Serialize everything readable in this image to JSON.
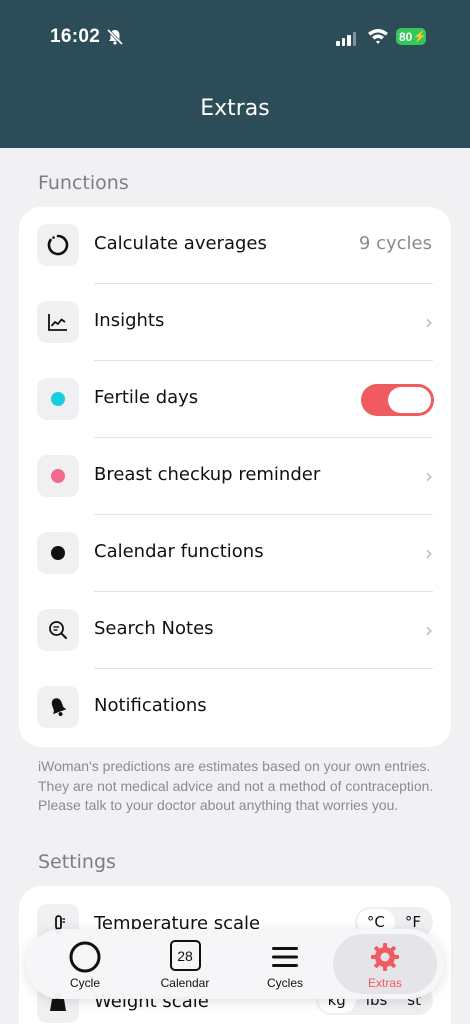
{
  "status_bar": {
    "time": "16:02",
    "battery": "80"
  },
  "header": {
    "title": "Extras"
  },
  "functions": {
    "section_title": "Functions",
    "items": [
      {
        "label": "Calculate averages",
        "value": "9 cycles",
        "icon": "circular-progress-icon"
      },
      {
        "label": "Insights",
        "icon": "line-chart-icon"
      },
      {
        "label": "Fertile days",
        "icon": "cyan-dot-icon",
        "toggle_on": true
      },
      {
        "label": "Breast checkup reminder",
        "icon": "pink-dot-icon"
      },
      {
        "label": "Calendar functions",
        "icon": "black-dot-icon"
      },
      {
        "label": "Search Notes",
        "icon": "search-notes-icon"
      },
      {
        "label": "Notifications",
        "icon": "bell-icon"
      }
    ]
  },
  "disclaimer": "iWoman's predictions are estimates based on your own entries. They are not medical advice and not a method of contraception. Please talk to your doctor about anything that worries you.",
  "settings": {
    "section_title": "Settings",
    "temperature": {
      "label": "Temperature scale",
      "options": [
        "°C",
        "°F"
      ],
      "selected": "°C"
    },
    "weight": {
      "label": "Weight scale",
      "options": [
        "kg",
        "lbs",
        "st"
      ],
      "selected": "kg"
    }
  },
  "tabbar": {
    "tabs": [
      {
        "label": "Cycle",
        "icon": "circle-icon"
      },
      {
        "label": "Calendar",
        "icon": "calendar-icon",
        "day": "28"
      },
      {
        "label": "Cycles",
        "icon": "list-icon"
      },
      {
        "label": "Extras",
        "icon": "gear-icon",
        "active": true
      }
    ]
  },
  "colors": {
    "header_bg": "#2c4d57",
    "accent": "#f05a61",
    "fertile_dot": "#19cde0",
    "breast_dot": "#f06a8a"
  }
}
